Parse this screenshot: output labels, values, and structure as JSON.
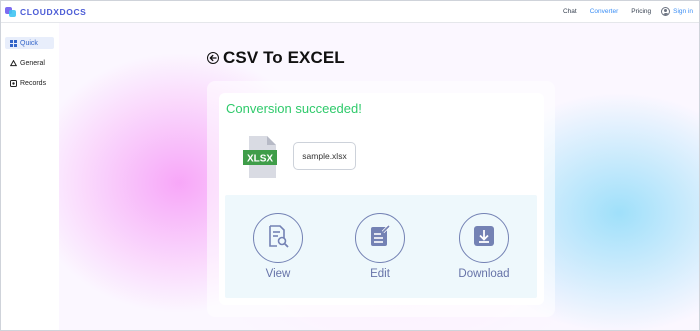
{
  "app": {
    "brand": "CLOUDXDOCS"
  },
  "nav": {
    "items": [
      {
        "label": "Chat",
        "active": false
      },
      {
        "label": "Converter",
        "active": true
      },
      {
        "label": "Pricing",
        "active": false
      }
    ],
    "signin_label": "Sign in"
  },
  "sidebar": {
    "items": [
      {
        "label": "Quick",
        "icon": "grid-icon",
        "active": true
      },
      {
        "label": "General",
        "icon": "recycle-icon",
        "active": false
      },
      {
        "label": "Records",
        "icon": "records-icon",
        "active": false
      }
    ]
  },
  "page": {
    "title": "CSV To EXCEL"
  },
  "result": {
    "status": "Conversion succeeded!",
    "file_badge": "XLSX",
    "file_name": "sample.xlsx",
    "actions": [
      {
        "label": "View",
        "icon": "view-document-icon"
      },
      {
        "label": "Edit",
        "icon": "edit-document-icon"
      },
      {
        "label": "Download",
        "icon": "download-icon"
      }
    ]
  },
  "colors": {
    "accent": "#3b8ef5",
    "success": "#2fca6b",
    "action": "#6673a8",
    "file_green": "#3f9d49"
  }
}
